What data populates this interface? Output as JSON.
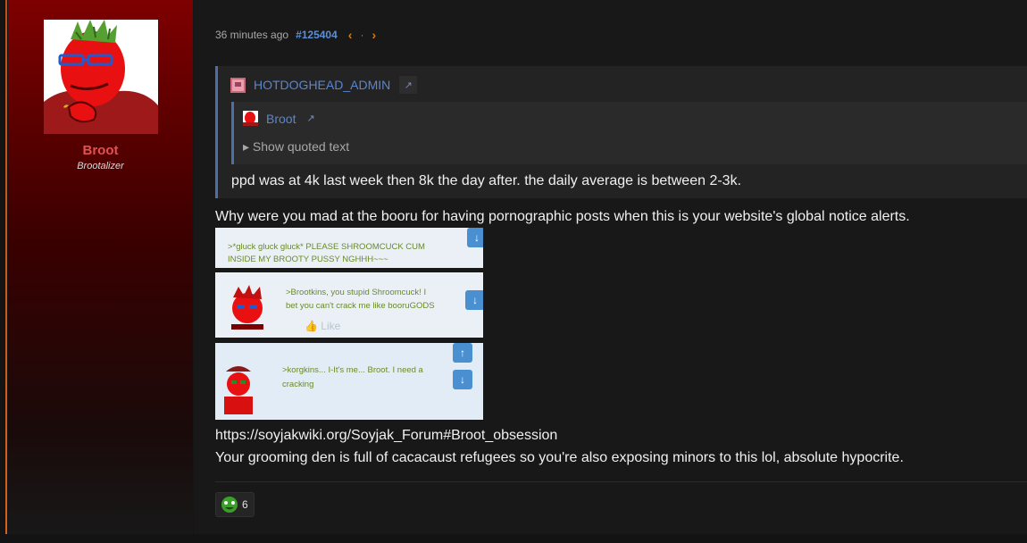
{
  "user": {
    "name": "Broot",
    "title": "Brootalizer"
  },
  "post": {
    "time": "36 minutes ago",
    "number": "#125404",
    "nav_prev": "‹",
    "nav_dot": "·",
    "nav_next": "›",
    "quote": {
      "author": "HOTDOGHEAD_ADMIN",
      "link_icon": "↗",
      "inner": {
        "author": "Broot",
        "link_icon": "↗",
        "show_quoted": "▸ Show quoted text"
      },
      "text": "ppd was at 4k last week then 8k the day after. the daily average is between 2-3k."
    },
    "line1": "Why were you mad at the booru for having pornographic posts when this is your website's global notice alerts.",
    "images": [
      {
        "text1": ">*gluck gluck gluck* PLEASE SHROOMCUCK CUM",
        "text2": "INSIDE MY BROOTY PUSSY NGHHH~~~"
      },
      {
        "text1": ">Brootkins, you stupid Shroomcuck! I",
        "text2": "bet you can't crack me like booruGODS",
        "like": "Like"
      },
      {
        "text1": ">korgkins... I-It's me... Broot. I need a",
        "text2": "cracking"
      }
    ],
    "url": "https://soyjakwiki.org/Soyjak_Forum#Broot_obsession",
    "line2": "Your grooming den is full of cacacaust refugees so you're also exposing minors to this lol, absolute hypocrite.",
    "reaction_count": "6"
  },
  "colors": {
    "accent_link": "#5a86cf",
    "username": "#e05252",
    "nav_orange": "#d97a1a",
    "panel_red": "#7e0000"
  }
}
